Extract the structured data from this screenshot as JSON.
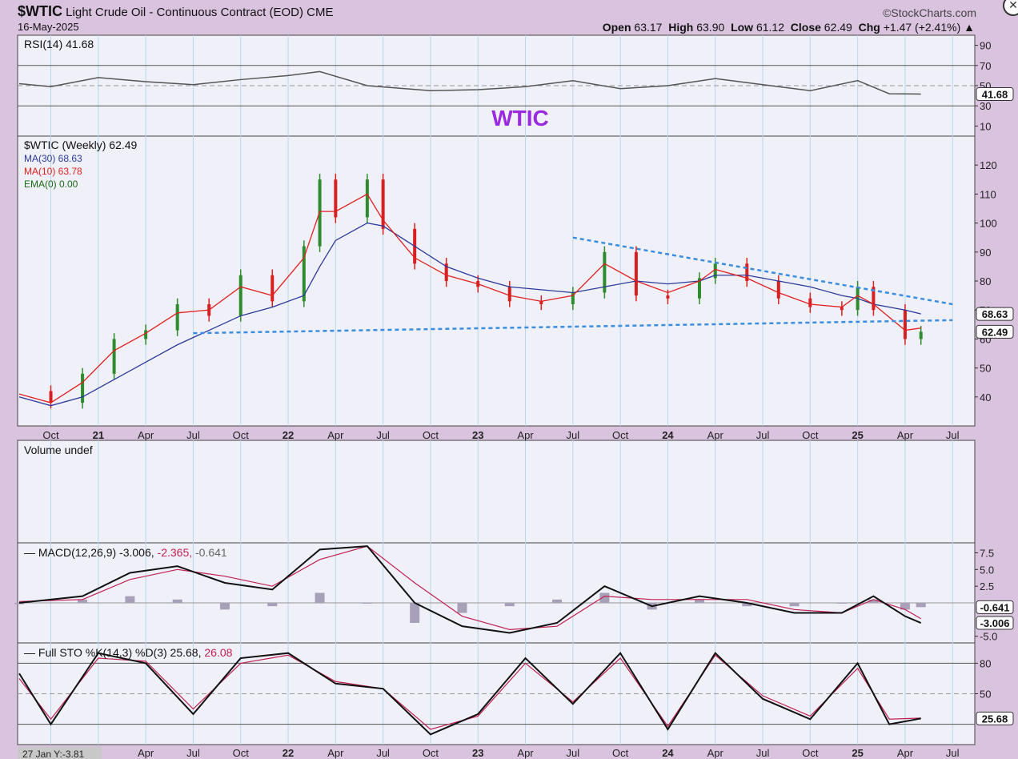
{
  "header": {
    "symbol": "$WTIC",
    "description": "Light Crude Oil - Continuous Contract (EOD)",
    "exchange": "CME",
    "date": "16-May-2025",
    "source": "©StockCharts.com",
    "open_label": "Open",
    "open": "63.17",
    "high_label": "High",
    "high": "63.90",
    "low_label": "Low",
    "low": "61.12",
    "close_label": "Close",
    "close": "62.49",
    "chg_label": "Chg",
    "chg": "+1.47 (+2.41%)"
  },
  "rsi_panel": {
    "legend": "RSI(14) 41.68",
    "watermark": "WTIC",
    "value_tag": "41.68",
    "ticks": [
      "90",
      "70",
      "50",
      "30",
      "10"
    ]
  },
  "price_panel": {
    "legend_main": "$WTIC (Weekly) 62.49",
    "legend_ma30": "MA(30) 68.63",
    "legend_ma10": "MA(10) 63.78",
    "legend_ema": "EMA(0) 0.00",
    "tag_ma30": "68.63",
    "tag_close": "62.49",
    "ticks": [
      "120",
      "110",
      "100",
      "90",
      "80",
      "70",
      "60",
      "50",
      "40"
    ]
  },
  "volume_panel": {
    "legend": "Volume undef"
  },
  "macd_panel": {
    "legend_name": "MACD(12,26,9)",
    "legend_v1": "-3.006,",
    "legend_v2": "-2.365,",
    "legend_v3": "-0.641",
    "tag_hist": "-0.641",
    "tag_macd": "-3.006",
    "ticks": [
      "7.5",
      "5.0",
      "2.5",
      "-5.0"
    ]
  },
  "sto_panel": {
    "legend_name": "Full STO %K(14,3) %D(3) 25.68,",
    "legend_v2": "26.08",
    "tag": "25.68",
    "ticks": [
      "80",
      "50"
    ]
  },
  "x_axis": {
    "labels": [
      "Oct",
      "21",
      "Apr",
      "Jul",
      "Oct",
      "22",
      "Apr",
      "Jul",
      "Oct",
      "23",
      "Apr",
      "Jul",
      "Oct",
      "24",
      "Apr",
      "Jul",
      "Oct",
      "25",
      "Apr",
      "Jul"
    ],
    "bottom_labels": [
      "1",
      "Apr",
      "Jul",
      "Oct",
      "22",
      "Apr",
      "Jul",
      "Oct",
      "23",
      "Apr",
      "Jul",
      "Oct",
      "24",
      "Apr",
      "Jul",
      "Oct",
      "25",
      "Apr",
      "Jul"
    ],
    "cursor_readout": "27 Jan Y:-3.81"
  },
  "colors": {
    "panel_bg": "#f0f0f8",
    "page_bg": "#d9c3df",
    "up": "#2e8b2e",
    "down": "#d82020",
    "ma30": "#2b3a9a",
    "ma10": "#e02020",
    "trend": "#3a8ee0",
    "watermark": "#9a2ae0"
  },
  "chart_data": [
    {
      "type": "line",
      "title": "RSI(14)",
      "ylim": [
        0,
        100
      ],
      "reference_lines": [
        70,
        50,
        30
      ],
      "x": [
        "2020-08",
        "2020-10",
        "2021-01",
        "2021-04",
        "2021-07",
        "2021-10",
        "2022-01",
        "2022-03",
        "2022-06",
        "2022-10",
        "2023-01",
        "2023-04",
        "2023-07",
        "2023-10",
        "2024-01",
        "2024-04",
        "2024-07",
        "2024-10",
        "2025-01",
        "2025-03",
        "2025-05"
      ],
      "values": [
        52,
        49,
        58,
        54,
        51,
        56,
        60,
        64,
        50,
        45,
        46,
        49,
        55,
        47,
        50,
        57,
        51,
        45,
        55,
        42,
        41.68
      ]
    },
    {
      "type": "candlestick",
      "title": "$WTIC (Weekly)",
      "ylim": [
        30,
        130
      ],
      "last_close": 62.49,
      "x": [
        "2020-08",
        "2020-10",
        "2020-12",
        "2021-02",
        "2021-04",
        "2021-06",
        "2021-08",
        "2021-10",
        "2021-12",
        "2022-02",
        "2022-03",
        "2022-04",
        "2022-06",
        "2022-07",
        "2022-09",
        "2022-11",
        "2023-01",
        "2023-03",
        "2023-05",
        "2023-07",
        "2023-09",
        "2023-11",
        "2024-01",
        "2024-03",
        "2024-04",
        "2024-06",
        "2024-08",
        "2024-10",
        "2024-12",
        "2025-01",
        "2025-02",
        "2025-04",
        "2025-05"
      ],
      "series": [
        {
          "name": "$WTIC",
          "values": [
            42,
            38,
            48,
            60,
            63,
            72,
            68,
            82,
            73,
            92,
            115,
            102,
            115,
            98,
            86,
            80,
            78,
            73,
            72,
            76,
            90,
            75,
            74,
            81,
            86,
            80,
            74,
            71,
            70,
            78,
            70,
            60,
            62.49
          ]
        },
        {
          "name": "MA(30)",
          "values": [
            40,
            37,
            40,
            46,
            52,
            58,
            63,
            68,
            71,
            75,
            85,
            94,
            100,
            99,
            92,
            85,
            81,
            78,
            77,
            76,
            78,
            80,
            79,
            80,
            82,
            82,
            80,
            78,
            75,
            74,
            72,
            70,
            68.63
          ]
        },
        {
          "name": "MA(10)",
          "values": [
            41,
            38,
            45,
            56,
            62,
            69,
            70,
            78,
            75,
            88,
            104,
            104,
            110,
            101,
            88,
            82,
            79,
            75,
            73,
            75,
            86,
            80,
            76,
            80,
            84,
            81,
            76,
            72,
            71,
            75,
            72,
            63,
            63.78
          ]
        }
      ],
      "trendlines": [
        {
          "from": [
            "2021-07",
            62
          ],
          "to": [
            "2025-07",
            66.5
          ]
        },
        {
          "from": [
            "2023-07",
            95
          ],
          "to": [
            "2025-07",
            72
          ]
        }
      ]
    },
    {
      "type": "line",
      "title": "MACD(12,26,9)",
      "ylim": [
        -6,
        9
      ],
      "x": [
        "2020-08",
        "2020-12",
        "2021-03",
        "2021-06",
        "2021-09",
        "2021-12",
        "2022-03",
        "2022-06",
        "2022-09",
        "2022-12",
        "2023-03",
        "2023-06",
        "2023-09",
        "2023-12",
        "2024-03",
        "2024-06",
        "2024-09",
        "2024-12",
        "2025-02",
        "2025-04",
        "2025-05"
      ],
      "series": [
        {
          "name": "MACD",
          "values": [
            0,
            1,
            4.5,
            5.5,
            3,
            2,
            8,
            8.5,
            0,
            -3.5,
            -4.5,
            -3,
            2.5,
            -0.5,
            1,
            0,
            -1.5,
            -1.5,
            1,
            -2,
            -3.006
          ]
        },
        {
          "name": "Signal",
          "values": [
            0.2,
            0.5,
            3.5,
            5,
            4,
            2.5,
            6.5,
            8.5,
            3,
            -2,
            -4,
            -3.5,
            1,
            0.5,
            0.5,
            0.5,
            -1,
            -1.5,
            0.5,
            -1,
            -2.365
          ]
        }
      ]
    },
    {
      "type": "line",
      "title": "Full STO %K(14,3) %D(3)",
      "ylim": [
        0,
        100
      ],
      "reference_lines": [
        80,
        50,
        20
      ],
      "x": [
        "2020-08",
        "2020-10",
        "2021-01",
        "2021-04",
        "2021-07",
        "2021-10",
        "2022-01",
        "2022-04",
        "2022-07",
        "2022-10",
        "2023-01",
        "2023-04",
        "2023-07",
        "2023-10",
        "2024-01",
        "2024-04",
        "2024-07",
        "2024-10",
        "2025-01",
        "2025-03",
        "2025-05"
      ],
      "series": [
        {
          "name": "%K",
          "values": [
            70,
            20,
            90,
            80,
            30,
            85,
            90,
            60,
            55,
            10,
            30,
            85,
            40,
            90,
            15,
            90,
            45,
            25,
            80,
            20,
            25.68
          ]
        },
        {
          "name": "%D",
          "values": [
            65,
            25,
            85,
            82,
            35,
            80,
            88,
            62,
            55,
            15,
            28,
            80,
            42,
            85,
            18,
            88,
            48,
            28,
            75,
            25,
            26.08
          ]
        }
      ]
    }
  ]
}
